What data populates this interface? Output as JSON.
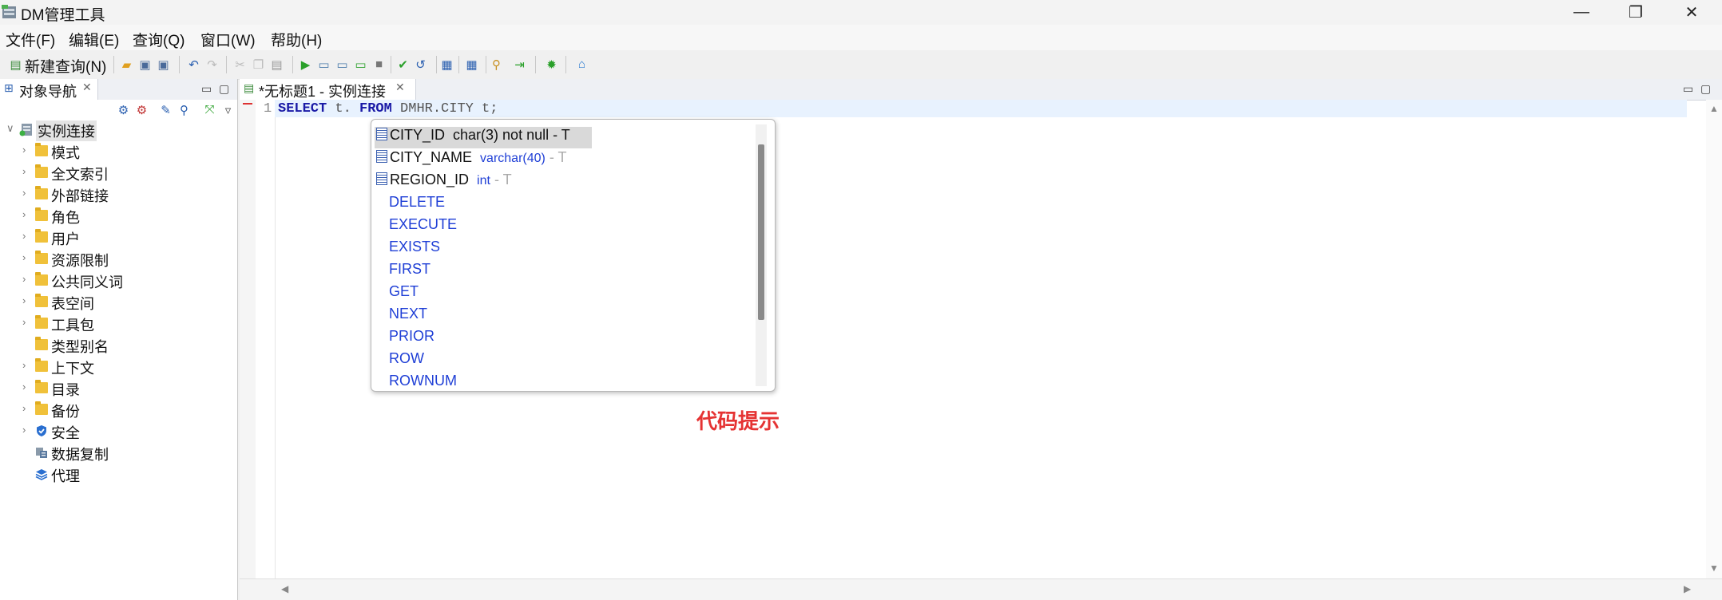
{
  "window": {
    "title": "DM管理工具",
    "controls": [
      "—",
      "❐",
      "✕"
    ]
  },
  "menu": [
    "文件(F)",
    "编辑(E)",
    "查询(Q)",
    "窗口(W)",
    "帮助(H)"
  ],
  "toolbar": {
    "new_query_label": "新建查询(N)"
  },
  "navigator": {
    "tab_label": "对象导航",
    "root": "实例连接",
    "items": [
      {
        "label": "模式",
        "icon": "folder-icon",
        "expandable": true
      },
      {
        "label": "全文索引",
        "icon": "folder-icon",
        "expandable": true
      },
      {
        "label": "外部链接",
        "icon": "folder-icon",
        "expandable": true
      },
      {
        "label": "角色",
        "icon": "folder-icon",
        "expandable": true
      },
      {
        "label": "用户",
        "icon": "folder-icon",
        "expandable": true
      },
      {
        "label": "资源限制",
        "icon": "folder-icon",
        "expandable": true
      },
      {
        "label": "公共同义词",
        "icon": "folder-icon",
        "expandable": true
      },
      {
        "label": "表空间",
        "icon": "folder-icon",
        "expandable": true
      },
      {
        "label": "工具包",
        "icon": "folder-icon",
        "expandable": true
      },
      {
        "label": "类型别名",
        "icon": "folder-icon",
        "expandable": false
      },
      {
        "label": "上下文",
        "icon": "folder-icon",
        "expandable": true
      },
      {
        "label": "目录",
        "icon": "folder-icon",
        "expandable": true
      },
      {
        "label": "备份",
        "icon": "folder-icon",
        "expandable": true
      },
      {
        "label": "安全",
        "icon": "shield-icon",
        "expandable": true
      },
      {
        "label": "数据复制",
        "icon": "replication-icon",
        "expandable": false
      },
      {
        "label": "代理",
        "icon": "layers-icon",
        "expandable": false
      }
    ]
  },
  "editor": {
    "tab_label": "*无标题1 - 实例连接",
    "line_number": "1",
    "code": {
      "kw1": "SELECT",
      "t1": " t. ",
      "kw2": "FROM",
      "t2": " DMHR.CITY t;"
    }
  },
  "completion": {
    "columns": [
      {
        "name": "CITY_ID",
        "type": "char(3) not null",
        "sep": " - ",
        "table": "T"
      },
      {
        "name": "CITY_NAME",
        "type": "varchar(40)",
        "sep": " - ",
        "table": "T"
      },
      {
        "name": "REGION_ID",
        "type": "int",
        "sep": " - ",
        "table": "T"
      }
    ],
    "keywords": [
      "DELETE",
      "EXECUTE",
      "EXISTS",
      "FIRST",
      "GET",
      "NEXT",
      "PRIOR",
      "ROW",
      "ROWNUM"
    ]
  },
  "annotation": "代码提示",
  "colors": {
    "keyword": "#1a1aa6",
    "completion_keyword": "#1f3fd6",
    "annotation": "#e53333"
  }
}
